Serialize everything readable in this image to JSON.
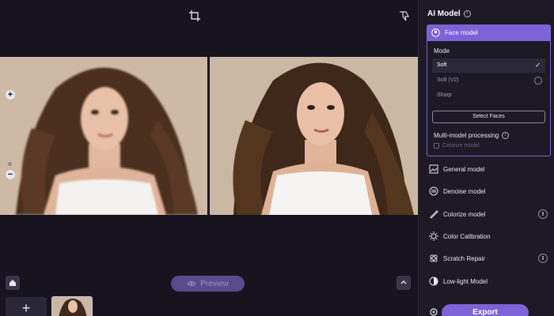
{
  "toolbar": {
    "crop_icon": "crop-icon",
    "dislike_icon": "thumbs-down-icon"
  },
  "canvas": {
    "zoom_in_label": "+",
    "zoom_out_label": "−"
  },
  "bottom": {
    "preview_label": "Preview",
    "add_label": "+",
    "home_icon": "home-icon",
    "collapse_icon": "chevron-up-icon"
  },
  "panel": {
    "title": "AI Model",
    "face_model": {
      "label": "Face model",
      "mode_label": "Mode",
      "options": [
        {
          "label": "Soft",
          "selected": true
        },
        {
          "label": "Soft (V2)",
          "selected": false
        },
        {
          "label": "Sharp",
          "selected": false
        }
      ],
      "select_faces_label": "Select Faces",
      "multi_model_label": "Multi-model processing",
      "colorize_checkbox_label": "Colorize model"
    },
    "models": [
      {
        "label": "General model",
        "icon": "image-icon",
        "download": false
      },
      {
        "label": "Denoise model",
        "icon": "denoise-icon",
        "download": false
      },
      {
        "label": "Colorize model",
        "icon": "brush-icon",
        "download": true
      },
      {
        "label": "Color Calibration",
        "icon": "sun-icon",
        "download": false
      },
      {
        "label": "Scratch Repair",
        "icon": "bandage-icon",
        "download": true
      },
      {
        "label": "Low-light Model",
        "icon": "half-circle-icon",
        "download": false
      }
    ],
    "export_label": "Export"
  },
  "colors": {
    "accent": "#7d63d8",
    "background": "#17141f",
    "panel": "#1d1a26"
  }
}
